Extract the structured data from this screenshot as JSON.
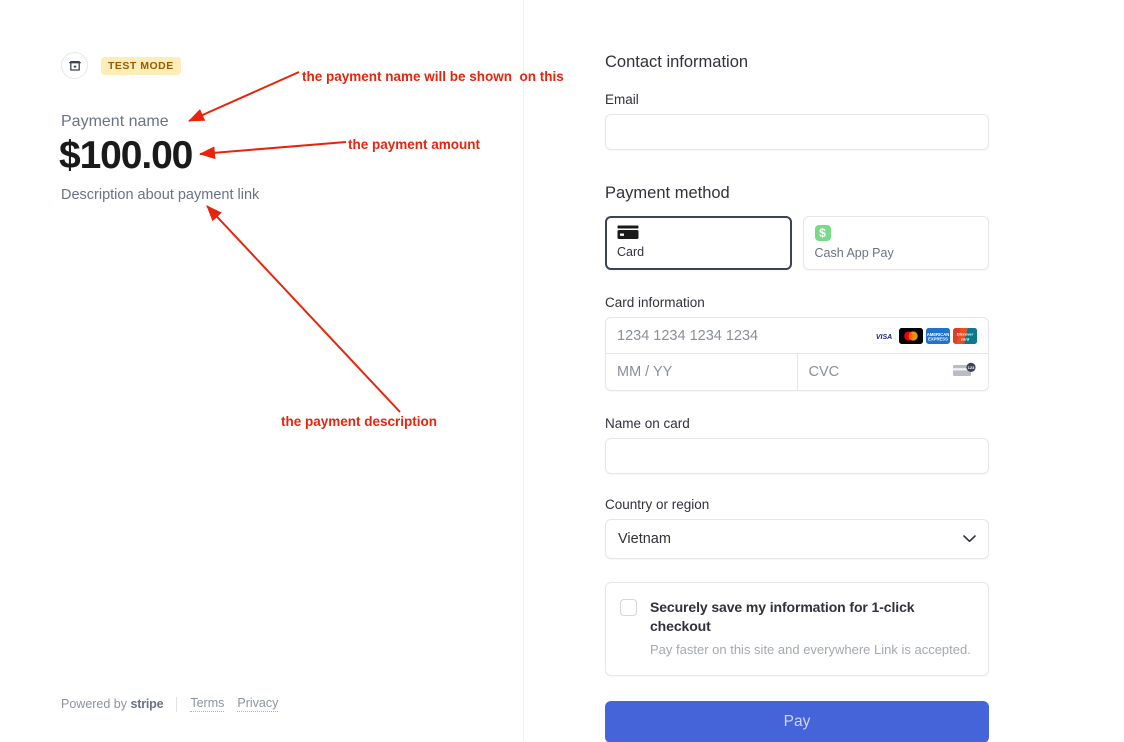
{
  "left": {
    "merchant_icon": "storefront-icon",
    "test_badge": "TEST MODE",
    "payment_name": "Payment name",
    "payment_amount": "$100.00",
    "payment_description": "Description about payment link",
    "footer": {
      "powered_by": "Powered by",
      "brand": "stripe",
      "terms": "Terms",
      "privacy": "Privacy"
    }
  },
  "right": {
    "contact": {
      "title": "Contact information",
      "email_label": "Email",
      "email_value": "",
      "email_placeholder": ""
    },
    "payment_method": {
      "title": "Payment method",
      "tabs": [
        {
          "label": "Card",
          "icon": "credit-card-icon",
          "selected": true
        },
        {
          "label": "Cash App Pay",
          "icon": "cash-app-dollar-icon",
          "selected": false
        }
      ]
    },
    "card_information": {
      "label": "Card information",
      "number_placeholder": "1234 1234 1234 1234",
      "number_value": "",
      "expiry_placeholder": "MM / YY",
      "expiry_value": "",
      "cvc_placeholder": "CVC",
      "cvc_value": "",
      "brands": [
        "visa",
        "mastercard",
        "amex",
        "discover"
      ],
      "cvc_icon": "cvc-card-icon"
    },
    "name_on_card": {
      "label": "Name on card",
      "value": "",
      "placeholder": ""
    },
    "country": {
      "label": "Country or region",
      "selected": "Vietnam",
      "chevron": "chevron-down-icon"
    },
    "link_save": {
      "checked": false,
      "title": "Securely save my information for 1-click checkout",
      "subtitle": "Pay faster on this site and everywhere Link is accepted."
    },
    "pay_button": "Pay"
  },
  "annotations": [
    {
      "id": "name",
      "text": "the payment name will be shown  on this"
    },
    {
      "id": "amount",
      "text": "the payment amount"
    },
    {
      "id": "desc",
      "text": "the payment description"
    }
  ],
  "colors": {
    "annotation_red": "#e8240c",
    "pay_blue": "#4664d9",
    "badge_bg": "#fcedb9",
    "badge_text": "#9b5b02",
    "cashapp_green": "#77db87"
  }
}
